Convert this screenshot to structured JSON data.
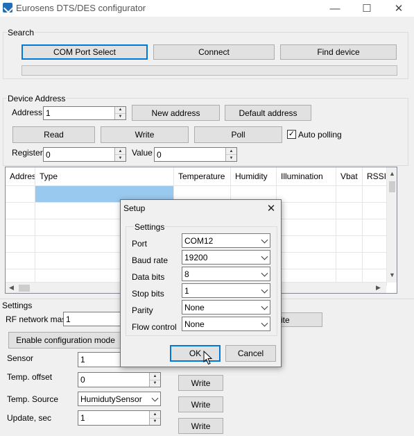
{
  "window": {
    "title": "Eurosens DTS/DES configurator",
    "minimize": "—",
    "maximize": "☐",
    "close": "✕"
  },
  "search": {
    "group_label": "Search",
    "com_port_button": "COM Port Select",
    "connect_button": "Connect",
    "find_device_button": "Find device",
    "progress": 0
  },
  "device_address": {
    "group_label": "Device Address",
    "address_label": "Address",
    "address_value": "1",
    "new_address_button": "New address",
    "default_address_button": "Default address",
    "read_button": "Read",
    "write_button": "Write",
    "poll_button": "Poll",
    "auto_polling_label": "Auto polling",
    "auto_polling_checked": true,
    "register_label": "Register",
    "register_value": "0",
    "value_label": "Value",
    "value_value": "0"
  },
  "grid": {
    "columns": [
      "Addres",
      "Type",
      "Temperature",
      "Humidity",
      "Illumination",
      "Vbat",
      "RSSI"
    ],
    "selected_row": 0
  },
  "settings": {
    "group_label": "Settings",
    "rf_mask_label": "RF network mask",
    "rf_mask_value": "1",
    "rf_write_partial": "ite",
    "enable_config_button": "Enable configuration mode",
    "sensor_label": "Sensor",
    "sensor_value": "1",
    "temp_offset_label": "Temp. offset",
    "temp_offset_value": "0",
    "temp_offset_write": "Write",
    "temp_source_label": "Temp. Source",
    "temp_source_value": "HumidutySensor",
    "temp_source_write": "Write",
    "update_label": "Update, sec",
    "update_value": "1",
    "update_write": "Write"
  },
  "dialog": {
    "title": "Setup",
    "close": "✕",
    "group_label": "Settings",
    "port_label": "Port",
    "port_value": "COM12",
    "baud_label": "Baud rate",
    "baud_value": "19200",
    "databits_label": "Data bits",
    "databits_value": "8",
    "stopbits_label": "Stop bits",
    "stopbits_value": "1",
    "parity_label": "Parity",
    "parity_value": "None",
    "flow_label": "Flow control",
    "flow_value": "None",
    "ok_button": "OK",
    "cancel_button": "Cancel"
  },
  "colors": {
    "accent": "#0078d7",
    "selected_cell": "#99c9ef"
  }
}
